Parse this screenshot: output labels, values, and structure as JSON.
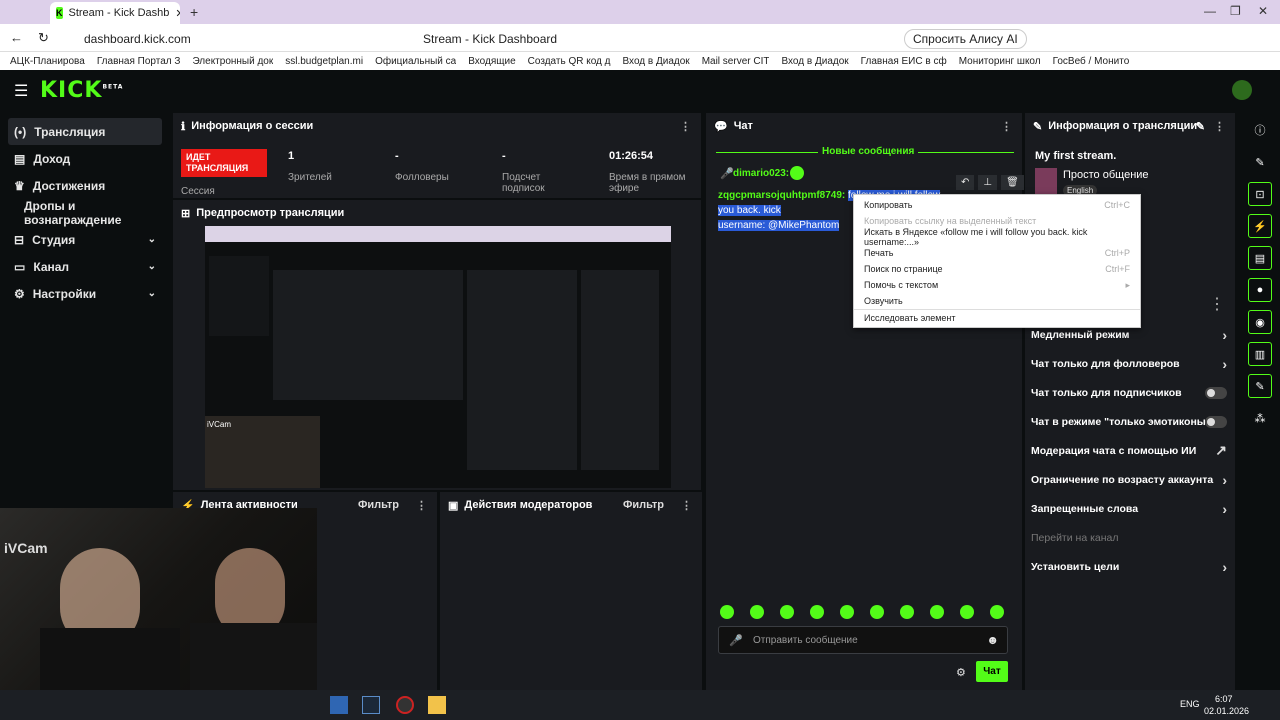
{
  "browser": {
    "tab_title": "Stream - Kick Dashb",
    "url": "dashboard.kick.com",
    "page_title": "Stream - Kick Dashboard",
    "alice": "Спросить Алису AI",
    "bookmarks": [
      "АЦК-Планирова",
      "Главная Портал З",
      "Электронный док",
      "ssl.budgetplan.mi",
      "Официальный са",
      "Входящие",
      "Создать QR код д",
      "Вход в Диадок",
      "Mail server CIT",
      "Вход в Диадок",
      "Главная ЕИС в сф",
      "Мониторинг школ",
      "ГосВеб / Монито"
    ]
  },
  "app": {
    "logo": "KICK",
    "logo_tag": "BETA"
  },
  "sidebar": {
    "items": [
      {
        "label": "Трансляция",
        "icon": "(•)"
      },
      {
        "label": "Доход",
        "icon": "▤"
      },
      {
        "label": "Достижения",
        "icon": "♛"
      },
      {
        "label": "Дропы и вознаграждение",
        "icon": ""
      },
      {
        "label": "Студия",
        "icon": "⊟"
      },
      {
        "label": "Канал",
        "icon": "▭"
      },
      {
        "label": "Настройки",
        "icon": "⚙"
      }
    ]
  },
  "session": {
    "title": "Информация о сессии",
    "live": "ИДЕТ ТРАНСЛЯЦИЯ",
    "session_label": "Сессия",
    "viewers_value": "1",
    "viewers_label": "Зрителей",
    "followers_value": "-",
    "followers_label": "Фолловеры",
    "subs_value": "-",
    "subs_label": "Подсчет подписок",
    "time_value": "01:26:54",
    "time_label": "Время в прямом эфире"
  },
  "preview": {
    "title": "Предпросмотр трансляции",
    "cam_label": "iVCam"
  },
  "activity": {
    "title": "Лента активности",
    "filter": "Фильтр"
  },
  "modactions": {
    "title": "Действия модераторов",
    "filter": "Фильтр"
  },
  "chat": {
    "title": "Чат",
    "new_messages": "Новые сообщения",
    "user": "dimario023:",
    "msg_user": "zqgcpmarsojquhtpmf8749:",
    "msg_text": "follow me i will follow you back. kick",
    "msg_text2": "username: @MikePhantom",
    "placeholder": "Отправить сообщение",
    "send": "Чат"
  },
  "context_menu": {
    "items": [
      {
        "label": "Копировать",
        "shortcut": "Ctrl+C"
      },
      {
        "label": "Копировать ссылку на выделенный текст",
        "shortcut": ""
      },
      {
        "label": "Искать в Яндексе «follow me i will follow you back. kick username:...»",
        "shortcut": ""
      },
      {
        "label": "Печать",
        "shortcut": "Ctrl+P"
      },
      {
        "label": "Поиск по странице",
        "shortcut": "Ctrl+F"
      },
      {
        "label": "Помочь с текстом",
        "shortcut": "▸"
      },
      {
        "label": "Озвучить",
        "shortcut": ""
      },
      {
        "label": "Исследовать элемент",
        "shortcut": ""
      }
    ]
  },
  "stream_info": {
    "title": "Информация о трансляции",
    "stream_title": "My first stream.",
    "category": "Просто общение",
    "language": "English"
  },
  "chat_settings": {
    "rows": [
      {
        "label": "Медленный режим",
        "ctl": "›"
      },
      {
        "label": "Чат только для фолловеров",
        "ctl": "›"
      },
      {
        "label": "Чат только для подписчиков",
        "ctl": "toggle"
      },
      {
        "label": "Чат в режиме \"только эмотиконы\"",
        "ctl": "toggle"
      },
      {
        "label": "Модерация чата с помощью ИИ",
        "ctl": "↗"
      },
      {
        "label": "Ограничение по возрасту аккаунта",
        "ctl": "›"
      },
      {
        "label": "Запрещенные слова",
        "ctl": "›"
      },
      {
        "label": "Перейти на канал",
        "ctl": ""
      },
      {
        "label": "Установить цели",
        "ctl": "›"
      }
    ]
  },
  "taskbar": {
    "lang": "ENG",
    "time": "6:07",
    "date": "02.01.2026"
  }
}
